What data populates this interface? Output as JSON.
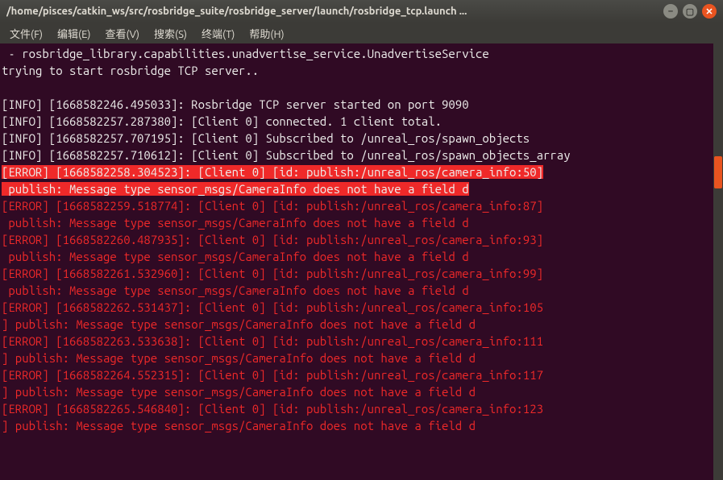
{
  "titlebar": {
    "title": "/home/pisces/catkin_ws/src/rosbridge_suite/rosbridge_server/launch/rosbridge_tcp.launch ..."
  },
  "menu": {
    "file": "文件(F)",
    "edit": "编辑(E)",
    "view": "查看(V)",
    "search": "搜索(S)",
    "terminal": "终端(T)",
    "help": "帮助(H)"
  },
  "term": {
    "l1": " - rosbridge_library.capabilities.unadvertise_service.UnadvertiseService",
    "l2": "trying to start rosbridge TCP server..",
    "l3": "",
    "l4": "[INFO] [1668582246.495033]: Rosbridge TCP server started on port 9090",
    "l5": "[INFO] [1668582257.287380]: [Client 0] connected. 1 client total.",
    "l6": "[INFO] [1668582257.707195]: [Client 0] Subscribed to /unreal_ros/spawn_objects",
    "l7": "[INFO] [1668582257.710612]: [Client 0] Subscribed to /unreal_ros/spawn_objects_array",
    "e1a": "[ERROR] [1668582258.304523]: [Client 0] [id: publish:/unreal_ros/camera_info:50]",
    "e1b": " publish: Message type sensor_msgs/CameraInfo does not have a field d",
    "e2a": "[ERROR] [1668582259.518774]: [Client 0] [id: publish:/unreal_ros/camera_info:87]",
    "e2b": " publish: Message type sensor_msgs/CameraInfo does not have a field d",
    "e3a": "[ERROR] [1668582260.487935]: [Client 0] [id: publish:/unreal_ros/camera_info:93]",
    "e3b": " publish: Message type sensor_msgs/CameraInfo does not have a field d",
    "e4a": "[ERROR] [1668582261.532960]: [Client 0] [id: publish:/unreal_ros/camera_info:99]",
    "e4b": " publish: Message type sensor_msgs/CameraInfo does not have a field d",
    "e5a": "[ERROR] [1668582262.531437]: [Client 0] [id: publish:/unreal_ros/camera_info:105",
    "e5b": "] publish: Message type sensor_msgs/CameraInfo does not have a field d",
    "e6a": "[ERROR] [1668582263.533638]: [Client 0] [id: publish:/unreal_ros/camera_info:111",
    "e6b": "] publish: Message type sensor_msgs/CameraInfo does not have a field d",
    "e7a": "[ERROR] [1668582264.552315]: [Client 0] [id: publish:/unreal_ros/camera_info:117",
    "e7b": "] publish: Message type sensor_msgs/CameraInfo does not have a field d",
    "e8a": "[ERROR] [1668582265.546840]: [Client 0] [id: publish:/unreal_ros/camera_info:123",
    "e8b": "] publish: Message type sensor_msgs/CameraInfo does not have a field d"
  }
}
